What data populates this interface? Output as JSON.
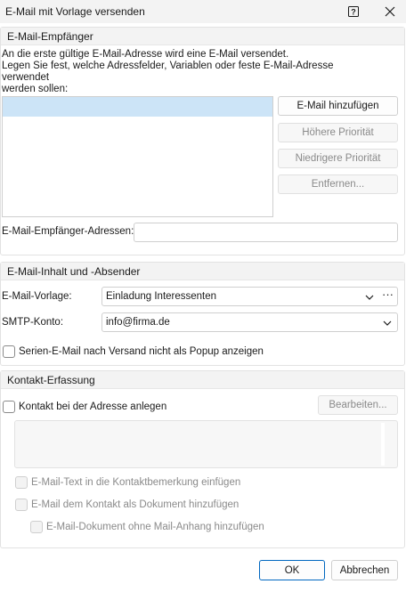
{
  "window": {
    "title": "E-Mail mit Vorlage versenden",
    "help_glyph": "?"
  },
  "recipients": {
    "section_title": "E-Mail-Empfänger",
    "description_lines": [
      "An die erste gültige E-Mail-Adresse wird eine E-Mail versendet.",
      "Legen Sie fest, welche Adressfelder, Variablen oder feste E-Mail-Adresse verwendet",
      "werden sollen:"
    ],
    "add_button": "E-Mail hinzufügen",
    "higher_priority_button": "Höhere Priorität",
    "lower_priority_button": "Niedrigere Priorität",
    "remove_button": "Entfernen...",
    "addresses_label": "E-Mail-Empfänger-Adressen:",
    "addresses_value": ""
  },
  "content": {
    "section_title": "E-Mail-Inhalt und -Absender",
    "template_label": "E-Mail-Vorlage:",
    "template_value": "Einladung Interessenten",
    "more_glyph": "···",
    "smtp_label": "SMTP-Konto:",
    "smtp_value": "info@firma.de",
    "serial_checkbox_label": "Serien-E-Mail nach Versand nicht als Popup anzeigen"
  },
  "contact": {
    "section_title": "Kontakt-Erfassung",
    "create_contact_label": "Kontakt bei der Adresse anlegen",
    "edit_button": "Bearbeiten...",
    "insert_text_label": "E-Mail-Text in die Kontaktbemerkung einfügen",
    "add_document_label": "E-Mail dem Kontakt als Dokument hinzufügen",
    "doc_without_attachment_label": "E-Mail-Dokument ohne Mail-Anhang hinzufügen"
  },
  "footer": {
    "ok_button": "OK",
    "cancel_button": "Abbrechen"
  },
  "colors": {
    "accent": "#0067c0",
    "selection": "#cce4f7"
  }
}
